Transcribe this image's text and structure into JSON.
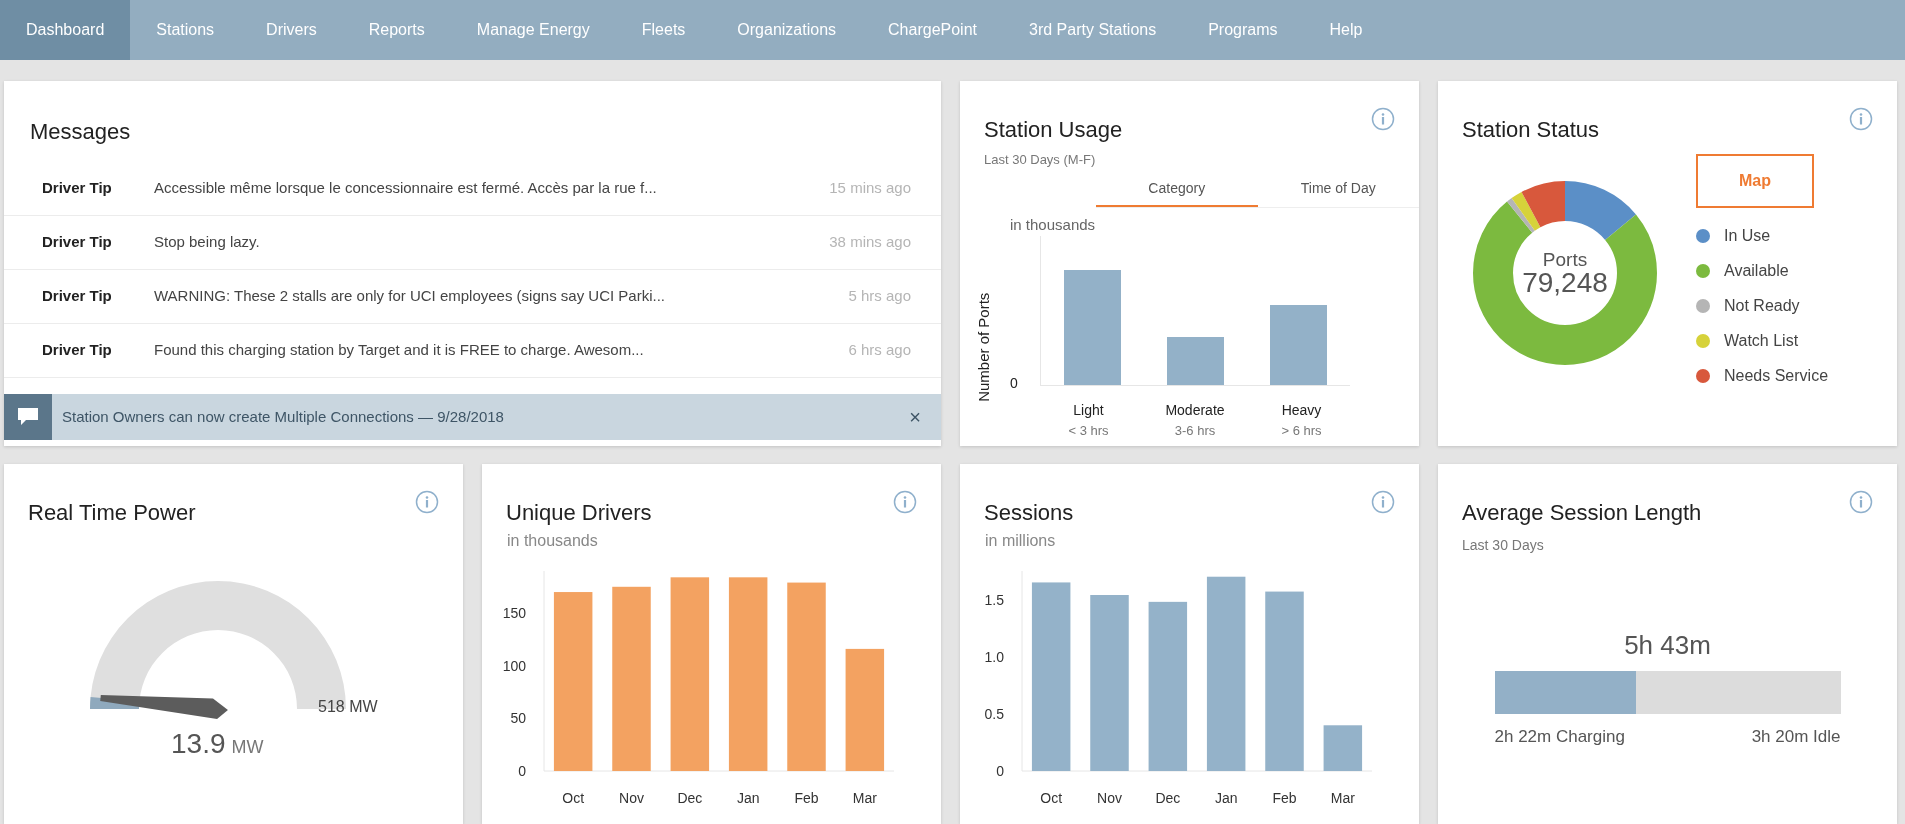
{
  "nav": [
    {
      "label": "Dashboard",
      "selected": true
    },
    {
      "label": "Stations",
      "selected": false
    },
    {
      "label": "Drivers",
      "selected": false
    },
    {
      "label": "Reports",
      "selected": false
    },
    {
      "label": "Manage Energy",
      "selected": false
    },
    {
      "label": "Fleets",
      "selected": false
    },
    {
      "label": "Organizations",
      "selected": false
    },
    {
      "label": "ChargePoint",
      "selected": false
    },
    {
      "label": "3rd Party Stations",
      "selected": false
    },
    {
      "label": "Programs",
      "selected": false
    },
    {
      "label": "Help",
      "selected": false
    }
  ],
  "messages": {
    "title": "Messages",
    "rows": [
      {
        "type": "Driver Tip",
        "text": "Accessible même lorsque le concessionnaire est fermé. Accès par la rue f...",
        "time": "15 mins ago"
      },
      {
        "type": "Driver Tip",
        "text": "Stop being lazy.",
        "time": "38 mins ago"
      },
      {
        "type": "Driver Tip",
        "text": "WARNING: These 2 stalls are only for UCI employees (signs say UCI Parki...",
        "time": "5 hrs ago"
      },
      {
        "type": "Driver Tip",
        "text": "Found this charging station by Target and it is FREE to charge. Awesom...",
        "time": "6 hrs ago"
      }
    ],
    "banner": {
      "text": "Station Owners can now create Multiple Connections — 9/28/2018",
      "close": "×"
    }
  },
  "station_usage": {
    "title": "Station Usage",
    "subtitle": "Last 30 Days (M-F)",
    "tabs": [
      {
        "label": "Category",
        "selected": true
      },
      {
        "label": "Time of Day",
        "selected": false
      }
    ],
    "unit": "in thousands",
    "ylabel": "Number of Ports",
    "zero_tick": "0",
    "categories": [
      {
        "label": "Light",
        "range": "< 3 hrs"
      },
      {
        "label": "Moderate",
        "range": "3-6 hrs"
      },
      {
        "label": "Heavy",
        "range": "> 6 hrs"
      }
    ]
  },
  "station_status": {
    "title": "Station Status",
    "map_button": "Map",
    "center_label": "Ports",
    "center_value": "79,248",
    "legend": [
      {
        "label": "In Use",
        "color": "#5b8fc7"
      },
      {
        "label": "Available",
        "color": "#7cba3f"
      },
      {
        "label": "Not Ready",
        "color": "#b5b5b5"
      },
      {
        "label": "Watch List",
        "color": "#d6d23a"
      },
      {
        "label": "Needs Service",
        "color": "#d8583c"
      }
    ]
  },
  "real_time_power": {
    "title": "Real Time Power",
    "level": 0.03,
    "value": "13.9",
    "unit": "MW",
    "max": "518 MW"
  },
  "unique_drivers": {
    "title": "Unique Drivers",
    "subtitle": "in thousands",
    "chart_data": {
      "type": "bar",
      "categories": [
        "Oct",
        "Nov",
        "Dec",
        "Jan",
        "Feb",
        "Mar"
      ],
      "values": [
        170,
        175,
        184,
        184,
        179,
        116
      ],
      "ylim": [
        0,
        190
      ],
      "yticks": [
        0,
        50,
        100,
        150
      ]
    }
  },
  "sessions": {
    "title": "Sessions",
    "subtitle": "in millions",
    "chart_data": {
      "type": "bar",
      "categories": [
        "Oct",
        "Nov",
        "Dec",
        "Jan",
        "Feb",
        "Mar"
      ],
      "values": [
        1.65,
        1.54,
        1.48,
        1.7,
        1.57,
        0.4
      ],
      "ylim": [
        0,
        1.75
      ],
      "yticks": [
        0,
        {
          "value": 0.5,
          "label": "0.5"
        },
        {
          "value": 1,
          "label": "1.0"
        },
        {
          "value": 1.5,
          "label": "1.5"
        }
      ]
    }
  },
  "avg_session": {
    "title": "Average Session Length",
    "subtitle": "Last 30 Days",
    "total": "5h 43m",
    "level": 0.41,
    "charging": "2h 22m Charging",
    "idle": "3h 20m Idle"
  }
}
